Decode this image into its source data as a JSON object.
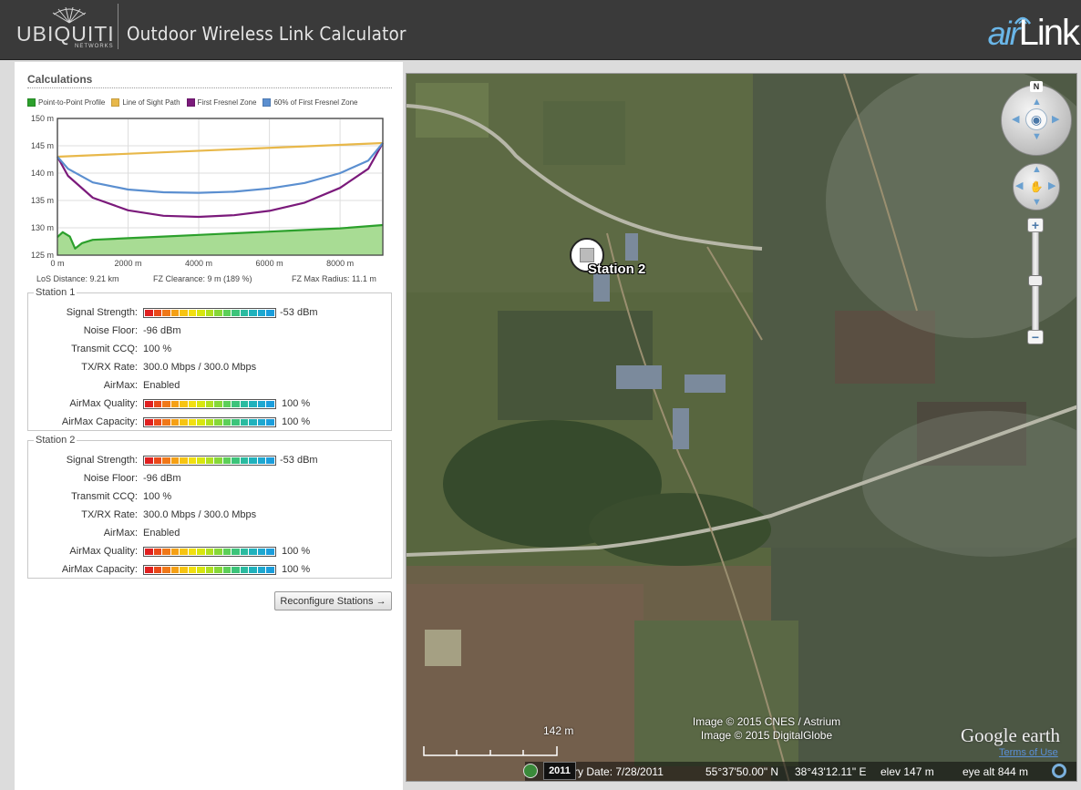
{
  "header": {
    "brand": "UBIQUITI",
    "brand_sub": "NETWORKS",
    "title": "Outdoor Wireless Link Calculator",
    "product_air": "air",
    "product_link": "Link"
  },
  "calculations": {
    "title": "Calculations",
    "legend": [
      {
        "label": "Point-to-Point Profile",
        "color": "#2ca02c"
      },
      {
        "label": "Line of Sight Path",
        "color": "#e8b84a"
      },
      {
        "label": "First Fresnel Zone",
        "color": "#7b1a7b"
      },
      {
        "label": "60% of First Fresnel Zone",
        "color": "#5b8fd0"
      }
    ],
    "los_distance": "LoS Distance: 9.21 km",
    "fz_clearance": "FZ Clearance: 9 m  (189 %)",
    "fz_max_radius": "FZ Max Radius: 11.1 m"
  },
  "chart_data": {
    "type": "line",
    "xlabel": "",
    "ylabel": "",
    "x_ticks": [
      "0 m",
      "2000 m",
      "4000 m",
      "6000 m",
      "8000 m"
    ],
    "y_ticks": [
      "125 m",
      "130 m",
      "135 m",
      "140 m",
      "145 m",
      "150 m"
    ],
    "xlim": [
      0,
      9210
    ],
    "ylim": [
      125,
      150
    ],
    "grid": true,
    "series": [
      {
        "name": "Line of Sight Path",
        "color": "#e8b84a",
        "x": [
          0,
          9210
        ],
        "y": [
          143,
          145.5
        ]
      },
      {
        "name": "First Fresnel Zone",
        "color": "#7b1a7b",
        "x": [
          0,
          300,
          1000,
          2000,
          3000,
          4000,
          5000,
          6000,
          7000,
          8000,
          8800,
          9210
        ],
        "y": [
          143,
          139.5,
          135.5,
          133.2,
          132.2,
          132.0,
          132.3,
          133.1,
          134.6,
          137.3,
          140.8,
          145.5
        ]
      },
      {
        "name": "60% of First Fresnel Zone",
        "color": "#5b8fd0",
        "x": [
          0,
          300,
          1000,
          2000,
          3000,
          4000,
          5000,
          6000,
          7000,
          8000,
          8800,
          9210
        ],
        "y": [
          143,
          140.8,
          138.3,
          137.0,
          136.5,
          136.4,
          136.6,
          137.2,
          138.2,
          140.0,
          142.3,
          145.5
        ]
      },
      {
        "name": "Point-to-Point Profile",
        "color": "#2ca02c",
        "fill": "#a8dc94",
        "x": [
          0,
          150,
          350,
          500,
          700,
          1000,
          2000,
          3000,
          4000,
          5000,
          6000,
          7000,
          8000,
          9210
        ],
        "y": [
          128.3,
          129.2,
          128.4,
          126.2,
          127.2,
          127.8,
          128.1,
          128.4,
          128.7,
          129.0,
          129.3,
          129.6,
          129.9,
          130.5
        ]
      }
    ]
  },
  "station1": {
    "legend": "Station 1",
    "signal_label": "Signal Strength:",
    "signal_value": "-53 dBm",
    "noise_label": "Noise Floor:",
    "noise_value": "-96 dBm",
    "ccq_label": "Transmit CCQ:",
    "ccq_value": "100 %",
    "rate_label": "TX/RX Rate:",
    "rate_value": "300.0 Mbps / 300.0 Mbps",
    "airmax_label": "AirMax:",
    "airmax_value": "Enabled",
    "quality_label": "AirMax Quality:",
    "quality_value": "100 %",
    "capacity_label": "AirMax Capacity:",
    "capacity_value": "100 %"
  },
  "station2": {
    "legend": "Station 2",
    "signal_label": "Signal Strength:",
    "signal_value": "-53 dBm",
    "noise_label": "Noise Floor:",
    "noise_value": "-96 dBm",
    "ccq_label": "Transmit CCQ:",
    "ccq_value": "100 %",
    "rate_label": "TX/RX Rate:",
    "rate_value": "300.0 Mbps / 300.0 Mbps",
    "airmax_label": "AirMax:",
    "airmax_value": "Enabled",
    "quality_label": "AirMax Quality:",
    "quality_value": "100 %",
    "capacity_label": "AirMax Capacity:",
    "capacity_value": "100 %"
  },
  "meter_colors": [
    "#e02020",
    "#ea4a1a",
    "#f07818",
    "#f5a015",
    "#f7c412",
    "#f2df10",
    "#d8e610",
    "#b0e020",
    "#86d838",
    "#5ccf58",
    "#3cc47a",
    "#2abba0",
    "#20b2bc",
    "#1ea8d0",
    "#1b9edc"
  ],
  "reconfigure_label": "Reconfigure Stations →",
  "map": {
    "station_label": "Station 2",
    "north_label": "N",
    "credit_1": "Image © 2015 CNES / Astrium",
    "credit_2": "Image © 2015 DigitalGlobe",
    "scale_label": "142 m",
    "google_earth": "Google earth",
    "terms": "Terms of Use",
    "year": "2011",
    "imagery_date": "agery Date: 7/28/2011",
    "lat": "55°37'50.00\" N",
    "lon": "38°43'12.11\" E",
    "elev": "elev   147 m",
    "eye_alt": "eye alt    844 m"
  }
}
